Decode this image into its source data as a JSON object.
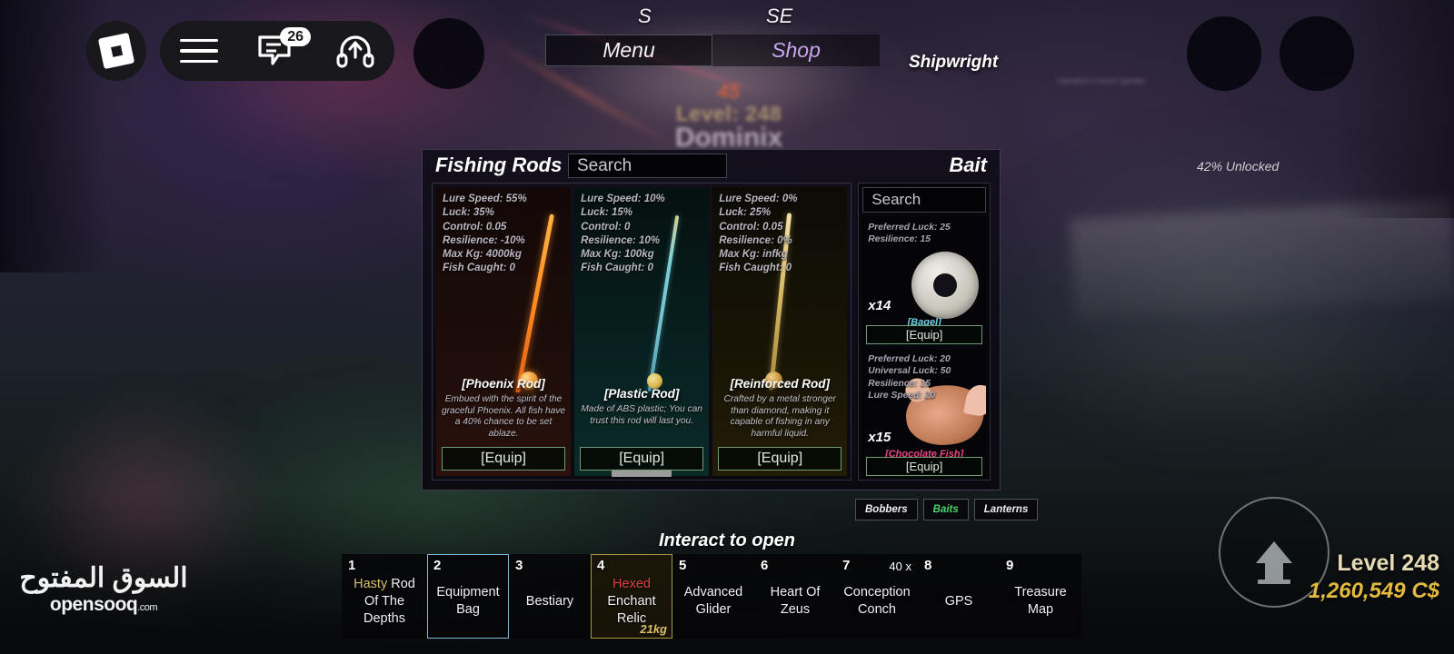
{
  "roblox_bar": {
    "logo_icon": "roblox-logo-icon",
    "menu_icon": "hamburger-menu-icon",
    "chat_icon": "chat-bubble-icon",
    "chat_badge": "26",
    "voice_icon": "headset-upload-icon"
  },
  "compass": {
    "s": "S",
    "se": "SE"
  },
  "top_buttons": {
    "menu": "Menu",
    "shop": "Shop"
  },
  "shipwright_label": "Shipwright",
  "npc": {
    "damage": "45",
    "level": "Level: 248",
    "name": "Dominix",
    "title": "Hanaka's Conch Spotter"
  },
  "panel": {
    "title_left": "Fishing Rods",
    "title_right": "Bait",
    "search_placeholder": "Search",
    "unlocked": "42% Unlocked",
    "bait_search_placeholder": "Search",
    "equip_label": "[Equip]",
    "rods": [
      {
        "name": "[Phoenix Rod]",
        "desc": "Embued with the spirit of the graceful Phoenix. All fish have a 40% chance to be set ablaze.",
        "stats": [
          "Lure Speed: 55%",
          "Luck: 35%",
          "Control: 0.05",
          "Resilience: -10%",
          "Max Kg: 4000kg",
          "Fish Caught: 0"
        ],
        "color": "#ff8a1f"
      },
      {
        "name": "[Plastic Rod]",
        "desc": "Made of ABS plastic; You can trust this rod will last you.",
        "stats": [
          "Lure Speed: 10%",
          "Luck: 15%",
          "Control: 0",
          "Resilience: 10%",
          "Max Kg: 100kg",
          "Fish Caught: 0"
        ],
        "color": "#6fbfd0"
      },
      {
        "name": "[Reinforced Rod]",
        "desc": "Crafted by a metal stronger than diamond, making it capable of fishing in any harmful liquid.",
        "stats": [
          "Lure Speed: 0%",
          "Luck: 25%",
          "Control: 0.05",
          "Resilience: 0%",
          "Max Kg: infkg",
          "Fish Caught: 0"
        ],
        "color": "#d9bd6a"
      }
    ],
    "baits": [
      {
        "name": "[Bagel]",
        "qty": "x14",
        "stats": [
          "Preferred Luck: 25",
          "Resilience: 15"
        ],
        "name_color": "#6fd3e8"
      },
      {
        "name": "[Chocolate Fish]",
        "qty": "x15",
        "stats": [
          "Preferred Luck: 20",
          "Universal Luck: 50",
          "Resilience: 15",
          "Lure Speed: 20"
        ],
        "name_color": "#e9477f"
      }
    ]
  },
  "bait_tabs": [
    {
      "label": "Bobbers",
      "active": false
    },
    {
      "label": "Baits",
      "active": true
    },
    {
      "label": "Lanterns",
      "active": false
    }
  ],
  "interact_prompt": "Interact to open",
  "hotbar": [
    {
      "num": "1",
      "label_gold": "Hasty",
      "label": " Rod Of The Depths",
      "count": "",
      "kg": "",
      "state": "normal"
    },
    {
      "num": "2",
      "label_gold": "",
      "label": "Equipment Bag",
      "count": "",
      "kg": "",
      "state": "selected"
    },
    {
      "num": "3",
      "label_gold": "",
      "label": "Bestiary",
      "count": "",
      "kg": "",
      "state": "normal"
    },
    {
      "num": "4",
      "label_red": "Hexed",
      "label": " Enchant Relic",
      "count": "",
      "kg": "21kg",
      "state": "gold"
    },
    {
      "num": "5",
      "label_gold": "",
      "label": "Advanced Glider",
      "count": "",
      "kg": "",
      "state": "normal"
    },
    {
      "num": "6",
      "label_gold": "",
      "label": "Heart Of Zeus",
      "count": "",
      "kg": "",
      "state": "normal"
    },
    {
      "num": "7",
      "label_gold": "",
      "label": "Conception Conch",
      "count": "40 x",
      "kg": "",
      "state": "normal"
    },
    {
      "num": "8",
      "label_gold": "",
      "label": "GPS",
      "count": "",
      "kg": "",
      "state": "normal"
    },
    {
      "num": "9",
      "label_gold": "",
      "label": "Treasure Map",
      "count": "",
      "kg": "",
      "state": "normal"
    }
  ],
  "hud": {
    "level": "Level 248",
    "cash": "1,260,549 C$",
    "jump_icon": "jump-arrow-up-icon"
  },
  "watermark": {
    "arabic": "السوق المفتوح",
    "latin": "opensooq",
    "tld": ".com"
  },
  "colors": {
    "accent_green": "#4fd26a",
    "equip_border": "#6f9c72",
    "gold": "#e3b93e",
    "level_cream": "#e6d9b4",
    "shop_purple": "#c9a7f0",
    "slot_selected": "#7fb9d6",
    "slot_gold": "#a8973e"
  }
}
